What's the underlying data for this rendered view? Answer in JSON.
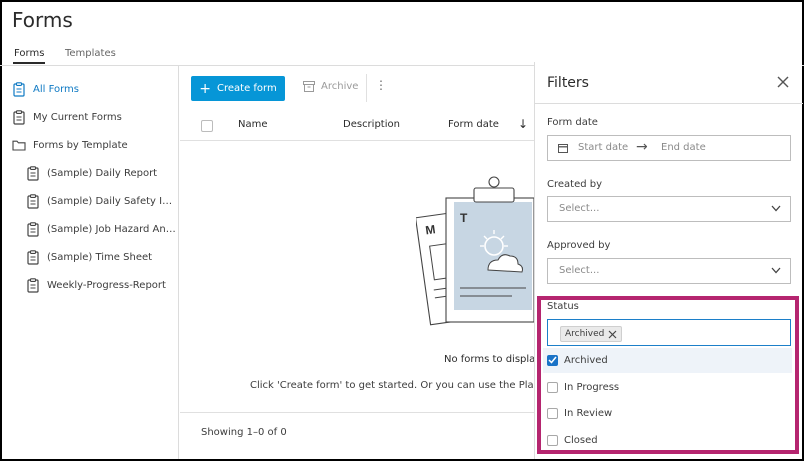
{
  "page": {
    "title": "Forms"
  },
  "tabs": [
    {
      "label": "Forms",
      "active": true
    },
    {
      "label": "Templates",
      "active": false
    }
  ],
  "sidebar": {
    "items": [
      {
        "label": "All Forms",
        "icon": "clipboard-icon",
        "active": true
      },
      {
        "label": "My Current Forms",
        "icon": "clipboard-icon"
      },
      {
        "label": "Forms by Template",
        "icon": "folder-icon"
      },
      {
        "label": "(Sample) Daily Report",
        "icon": "clipboard-icon"
      },
      {
        "label": "(Sample) Daily Safety I…",
        "icon": "clipboard-icon"
      },
      {
        "label": "(Sample) Job Hazard An…",
        "icon": "clipboard-icon"
      },
      {
        "label": "(Sample) Time Sheet",
        "icon": "clipboard-icon"
      },
      {
        "label": "Weekly-Progress-Report",
        "icon": "clipboard-icon"
      }
    ]
  },
  "toolbar": {
    "create_label": "Create form",
    "archive_label": "Archive",
    "more_label": "⋮"
  },
  "table": {
    "columns": [
      "Name",
      "Description",
      "Form date"
    ],
    "sort_indicator": "↓"
  },
  "empty": {
    "title": "No forms to display",
    "subtitle": "Click 'Create form' to get started. Or you can use the PlanGrid",
    "art_letters": {
      "left": "M",
      "right": "T"
    }
  },
  "footer": {
    "showing": "Showing 1–0 of 0"
  },
  "filters": {
    "title": "Filters",
    "form_date": {
      "label": "Form date",
      "start_placeholder": "Start date",
      "arrow": "→",
      "end_placeholder": "End date"
    },
    "created_by": {
      "label": "Created by",
      "placeholder": "Select..."
    },
    "approved_by": {
      "label": "Approved by",
      "placeholder": "Select..."
    },
    "status": {
      "label": "Status",
      "chip": "Archived",
      "options": [
        {
          "label": "Archived",
          "checked": true
        },
        {
          "label": "In Progress",
          "checked": false
        },
        {
          "label": "In Review",
          "checked": false
        },
        {
          "label": "Closed",
          "checked": false
        }
      ]
    }
  },
  "colors": {
    "accent": "#0696d7",
    "active_link": "#0f7ac4",
    "highlight": "#b5256f",
    "checkbox": "#1a73c7"
  }
}
